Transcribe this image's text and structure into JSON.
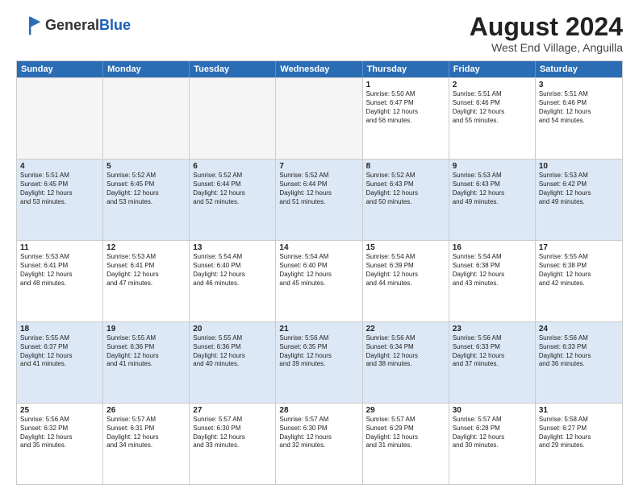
{
  "header": {
    "logo_line1": "General",
    "logo_line2": "Blue",
    "month_year": "August 2024",
    "location": "West End Village, Anguilla"
  },
  "days_of_week": [
    "Sunday",
    "Monday",
    "Tuesday",
    "Wednesday",
    "Thursday",
    "Friday",
    "Saturday"
  ],
  "weeks": [
    {
      "id": "week1",
      "parity": "even",
      "cells": [
        {
          "day": "",
          "empty": true,
          "lines": []
        },
        {
          "day": "",
          "empty": true,
          "lines": []
        },
        {
          "day": "",
          "empty": true,
          "lines": []
        },
        {
          "day": "",
          "empty": true,
          "lines": []
        },
        {
          "day": "1",
          "empty": false,
          "lines": [
            "Sunrise: 5:50 AM",
            "Sunset: 6:47 PM",
            "Daylight: 12 hours",
            "and 56 minutes."
          ]
        },
        {
          "day": "2",
          "empty": false,
          "lines": [
            "Sunrise: 5:51 AM",
            "Sunset: 6:46 PM",
            "Daylight: 12 hours",
            "and 55 minutes."
          ]
        },
        {
          "day": "3",
          "empty": false,
          "lines": [
            "Sunrise: 5:51 AM",
            "Sunset: 6:46 PM",
            "Daylight: 12 hours",
            "and 54 minutes."
          ]
        }
      ]
    },
    {
      "id": "week2",
      "parity": "odd",
      "cells": [
        {
          "day": "4",
          "empty": false,
          "lines": [
            "Sunrise: 5:51 AM",
            "Sunset: 6:45 PM",
            "Daylight: 12 hours",
            "and 53 minutes."
          ]
        },
        {
          "day": "5",
          "empty": false,
          "lines": [
            "Sunrise: 5:52 AM",
            "Sunset: 6:45 PM",
            "Daylight: 12 hours",
            "and 53 minutes."
          ]
        },
        {
          "day": "6",
          "empty": false,
          "lines": [
            "Sunrise: 5:52 AM",
            "Sunset: 6:44 PM",
            "Daylight: 12 hours",
            "and 52 minutes."
          ]
        },
        {
          "day": "7",
          "empty": false,
          "lines": [
            "Sunrise: 5:52 AM",
            "Sunset: 6:44 PM",
            "Daylight: 12 hours",
            "and 51 minutes."
          ]
        },
        {
          "day": "8",
          "empty": false,
          "lines": [
            "Sunrise: 5:52 AM",
            "Sunset: 6:43 PM",
            "Daylight: 12 hours",
            "and 50 minutes."
          ]
        },
        {
          "day": "9",
          "empty": false,
          "lines": [
            "Sunrise: 5:53 AM",
            "Sunset: 6:43 PM",
            "Daylight: 12 hours",
            "and 49 minutes."
          ]
        },
        {
          "day": "10",
          "empty": false,
          "lines": [
            "Sunrise: 5:53 AM",
            "Sunset: 6:42 PM",
            "Daylight: 12 hours",
            "and 49 minutes."
          ]
        }
      ]
    },
    {
      "id": "week3",
      "parity": "even",
      "cells": [
        {
          "day": "11",
          "empty": false,
          "lines": [
            "Sunrise: 5:53 AM",
            "Sunset: 6:41 PM",
            "Daylight: 12 hours",
            "and 48 minutes."
          ]
        },
        {
          "day": "12",
          "empty": false,
          "lines": [
            "Sunrise: 5:53 AM",
            "Sunset: 6:41 PM",
            "Daylight: 12 hours",
            "and 47 minutes."
          ]
        },
        {
          "day": "13",
          "empty": false,
          "lines": [
            "Sunrise: 5:54 AM",
            "Sunset: 6:40 PM",
            "Daylight: 12 hours",
            "and 46 minutes."
          ]
        },
        {
          "day": "14",
          "empty": false,
          "lines": [
            "Sunrise: 5:54 AM",
            "Sunset: 6:40 PM",
            "Daylight: 12 hours",
            "and 45 minutes."
          ]
        },
        {
          "day": "15",
          "empty": false,
          "lines": [
            "Sunrise: 5:54 AM",
            "Sunset: 6:39 PM",
            "Daylight: 12 hours",
            "and 44 minutes."
          ]
        },
        {
          "day": "16",
          "empty": false,
          "lines": [
            "Sunrise: 5:54 AM",
            "Sunset: 6:38 PM",
            "Daylight: 12 hours",
            "and 43 minutes."
          ]
        },
        {
          "day": "17",
          "empty": false,
          "lines": [
            "Sunrise: 5:55 AM",
            "Sunset: 6:38 PM",
            "Daylight: 12 hours",
            "and 42 minutes."
          ]
        }
      ]
    },
    {
      "id": "week4",
      "parity": "odd",
      "cells": [
        {
          "day": "18",
          "empty": false,
          "lines": [
            "Sunrise: 5:55 AM",
            "Sunset: 6:37 PM",
            "Daylight: 12 hours",
            "and 41 minutes."
          ]
        },
        {
          "day": "19",
          "empty": false,
          "lines": [
            "Sunrise: 5:55 AM",
            "Sunset: 6:36 PM",
            "Daylight: 12 hours",
            "and 41 minutes."
          ]
        },
        {
          "day": "20",
          "empty": false,
          "lines": [
            "Sunrise: 5:55 AM",
            "Sunset: 6:36 PM",
            "Daylight: 12 hours",
            "and 40 minutes."
          ]
        },
        {
          "day": "21",
          "empty": false,
          "lines": [
            "Sunrise: 5:56 AM",
            "Sunset: 6:35 PM",
            "Daylight: 12 hours",
            "and 39 minutes."
          ]
        },
        {
          "day": "22",
          "empty": false,
          "lines": [
            "Sunrise: 5:56 AM",
            "Sunset: 6:34 PM",
            "Daylight: 12 hours",
            "and 38 minutes."
          ]
        },
        {
          "day": "23",
          "empty": false,
          "lines": [
            "Sunrise: 5:56 AM",
            "Sunset: 6:33 PM",
            "Daylight: 12 hours",
            "and 37 minutes."
          ]
        },
        {
          "day": "24",
          "empty": false,
          "lines": [
            "Sunrise: 5:56 AM",
            "Sunset: 6:33 PM",
            "Daylight: 12 hours",
            "and 36 minutes."
          ]
        }
      ]
    },
    {
      "id": "week5",
      "parity": "even",
      "cells": [
        {
          "day": "25",
          "empty": false,
          "lines": [
            "Sunrise: 5:56 AM",
            "Sunset: 6:32 PM",
            "Daylight: 12 hours",
            "and 35 minutes."
          ]
        },
        {
          "day": "26",
          "empty": false,
          "lines": [
            "Sunrise: 5:57 AM",
            "Sunset: 6:31 PM",
            "Daylight: 12 hours",
            "and 34 minutes."
          ]
        },
        {
          "day": "27",
          "empty": false,
          "lines": [
            "Sunrise: 5:57 AM",
            "Sunset: 6:30 PM",
            "Daylight: 12 hours",
            "and 33 minutes."
          ]
        },
        {
          "day": "28",
          "empty": false,
          "lines": [
            "Sunrise: 5:57 AM",
            "Sunset: 6:30 PM",
            "Daylight: 12 hours",
            "and 32 minutes."
          ]
        },
        {
          "day": "29",
          "empty": false,
          "lines": [
            "Sunrise: 5:57 AM",
            "Sunset: 6:29 PM",
            "Daylight: 12 hours",
            "and 31 minutes."
          ]
        },
        {
          "day": "30",
          "empty": false,
          "lines": [
            "Sunrise: 5:57 AM",
            "Sunset: 6:28 PM",
            "Daylight: 12 hours",
            "and 30 minutes."
          ]
        },
        {
          "day": "31",
          "empty": false,
          "lines": [
            "Sunrise: 5:58 AM",
            "Sunset: 6:27 PM",
            "Daylight: 12 hours",
            "and 29 minutes."
          ]
        }
      ]
    }
  ]
}
